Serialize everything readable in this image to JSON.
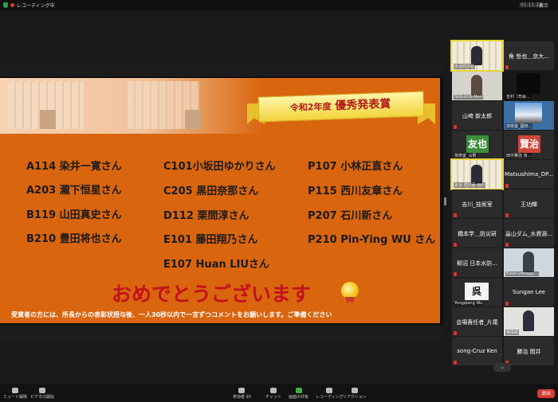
{
  "topbar": {
    "recording": "レコーディング中",
    "timer": "01:11:22",
    "view": "表示"
  },
  "slide": {
    "banner_small": "令和2年度",
    "banner_main": "優秀発表賞",
    "awards": [
      {
        "text": "A114 染井一寛さん"
      },
      {
        "text": "A203 瀧下恒星さん"
      },
      {
        "text": "B119 山田真史さん"
      },
      {
        "text": "B210 豊田将也さん"
      },
      {
        "text": "C101小坂田ゆかりさん"
      },
      {
        "text": "C205 黒田奈那さん"
      },
      {
        "text": "D112 栗間淳さん"
      },
      {
        "text": "E101 藤田翔乃さん"
      },
      {
        "text": "E107  Huan LIUさん"
      },
      {
        "text": "P107 小林正直さん"
      },
      {
        "text": "P115  西川友章さん"
      },
      {
        "text": "P207 石川新さん"
      },
      {
        "text": "P210 Pin-Ying WU さん"
      }
    ],
    "congrats": "おめでとうございます",
    "note": "受賞者の方には、所長からの表彰状授与後、一人30秒以内で一言ずつコメントをお願いします。ご準備ください"
  },
  "gallery": {
    "tiles": [
      {
        "name": "",
        "sub": "京大防災研"
      },
      {
        "name": "角 哲也＿京大...",
        "sub": ""
      },
      {
        "name": "",
        "sub": "Nobuhito Mori"
      },
      {
        "name": "",
        "sub": "吉村（司会..."
      },
      {
        "name": "山﨑 新太郎",
        "sub": ""
      },
      {
        "name": "",
        "sub": "技術室_國田..."
      },
      {
        "name": "友也",
        "sub": "技術室_山根"
      },
      {
        "name": "賢治",
        "sub": "田中賢治 京..."
      },
      {
        "name": "",
        "sub": "京大 防災研 田中"
      },
      {
        "name": "Matsushima_DP...",
        "sub": ""
      },
      {
        "name": "吉川_技術室",
        "sub": ""
      },
      {
        "name": "王功輝",
        "sub": ""
      },
      {
        "name": "橋本学＿防災研",
        "sub": ""
      },
      {
        "name": "畠山ダム_水資源...",
        "sub": ""
      },
      {
        "name": "柳沼 日本水防...",
        "sub": ""
      },
      {
        "name": "",
        "sub": "Kosei yamagu..."
      },
      {
        "name": "呉",
        "sub": "Yongqiang Wu"
      },
      {
        "name": "Sungae Lee",
        "sub": ""
      },
      {
        "name": "会場責任者_片尾",
        "sub": ""
      },
      {
        "name": "",
        "sub": "横澤鉄"
      },
      {
        "name": "song-Cruz Ken",
        "sub": ""
      },
      {
        "name": "勝治 間井",
        "sub": ""
      }
    ]
  },
  "toolbar": {
    "mute": "ミュート解除",
    "video": "ビデオの開始",
    "participants": "参加者",
    "participants_count": "93",
    "chat": "チャット",
    "share": "画面の共有",
    "record": "レコーディング",
    "reactions": "リアクション",
    "leave": "退出",
    "scroll": "⌄"
  },
  "colors": {
    "slide_bg": "#d9650e",
    "congrats": "#c3121c",
    "leave": "#d63c31",
    "active_speaker": "#e5d33a"
  }
}
